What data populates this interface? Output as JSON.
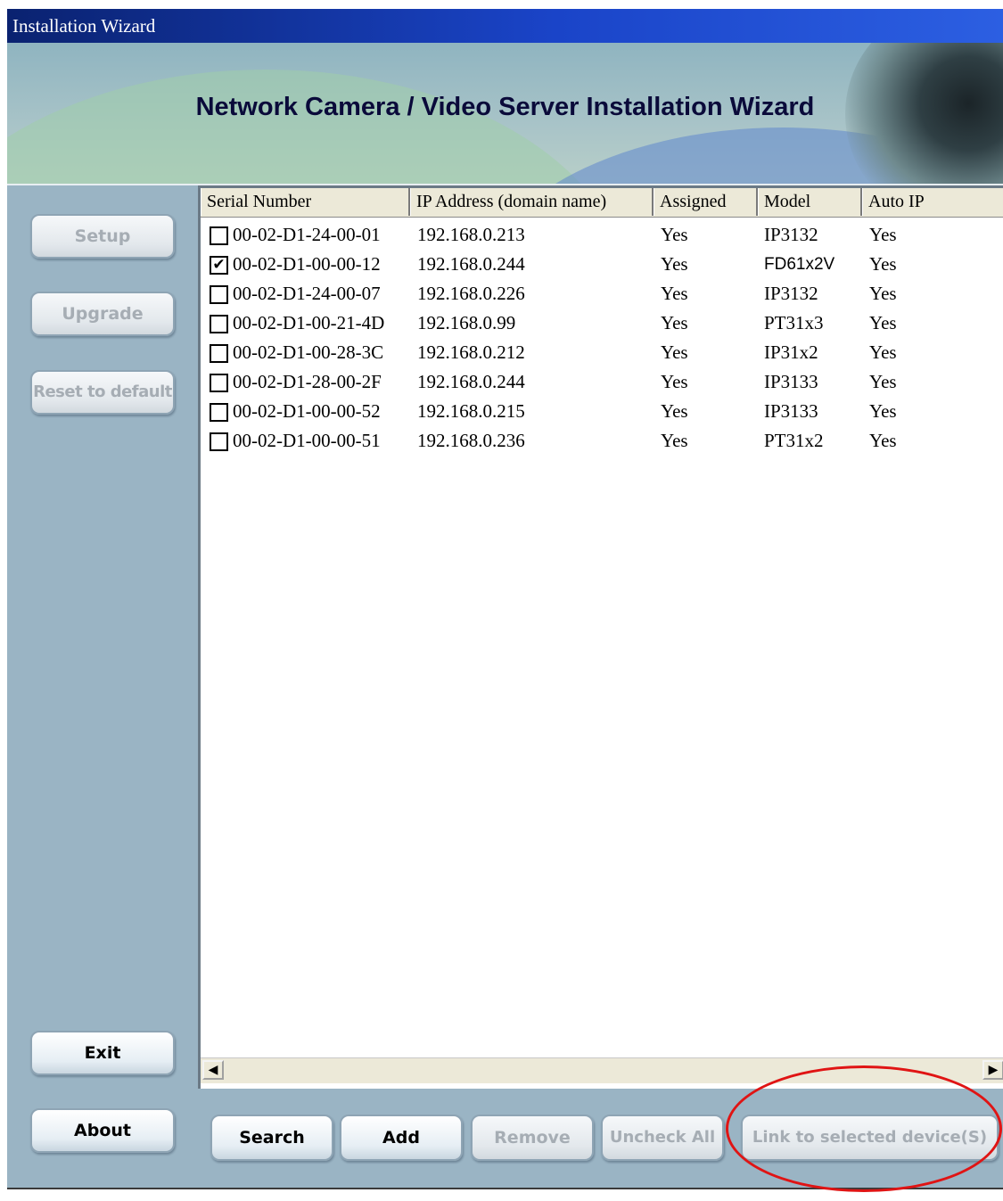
{
  "window": {
    "title": "Installation Wizard"
  },
  "banner": {
    "heading": "Network Camera / Video Server Installation Wizard"
  },
  "sidebar": {
    "setup": "Setup",
    "upgrade": "Upgrade",
    "reset": "Reset to default",
    "exit": "Exit",
    "about": "About"
  },
  "table": {
    "columns": [
      "Serial Number",
      "IP Address (domain name)",
      "Assigned",
      "Model",
      "Auto IP"
    ],
    "rows": [
      {
        "checked": false,
        "serial": "00-02-D1-24-00-01",
        "ip": "192.168.0.213",
        "assigned": "Yes",
        "model": "IP3132",
        "auto_ip": "Yes"
      },
      {
        "checked": true,
        "serial": "00-02-D1-00-00-12",
        "ip": "192.168.0.244",
        "assigned": "Yes",
        "model": "FD61x2V",
        "auto_ip": "Yes"
      },
      {
        "checked": false,
        "serial": "00-02-D1-24-00-07",
        "ip": "192.168.0.226",
        "assigned": "Yes",
        "model": "IP3132",
        "auto_ip": "Yes"
      },
      {
        "checked": false,
        "serial": "00-02-D1-00-21-4D",
        "ip": "192.168.0.99",
        "assigned": "Yes",
        "model": "PT31x3",
        "auto_ip": "Yes"
      },
      {
        "checked": false,
        "serial": "00-02-D1-00-28-3C",
        "ip": "192.168.0.212",
        "assigned": "Yes",
        "model": "IP31x2",
        "auto_ip": "Yes"
      },
      {
        "checked": false,
        "serial": "00-02-D1-28-00-2F",
        "ip": "192.168.0.244",
        "assigned": "Yes",
        "model": "IP3133",
        "auto_ip": "Yes"
      },
      {
        "checked": false,
        "serial": "00-02-D1-00-00-52",
        "ip": "192.168.0.215",
        "assigned": "Yes",
        "model": "IP3133",
        "auto_ip": "Yes"
      },
      {
        "checked": false,
        "serial": "00-02-D1-00-00-51",
        "ip": "192.168.0.236",
        "assigned": "Yes",
        "model": "PT31x2",
        "auto_ip": "Yes"
      }
    ]
  },
  "bottom": {
    "search": "Search",
    "add": "Add",
    "remove": "Remove",
    "uncheck_all": "Uncheck All",
    "link": "Link to selected device(S)"
  },
  "icons": {
    "scroll_left": "scroll-left-arrow-icon",
    "scroll_right": "scroll-right-arrow-icon",
    "check": "checkmark-icon"
  },
  "colors": {
    "annotation": "#e01414",
    "title_bar": "#0a2270",
    "panel": "#9ab4c4"
  }
}
